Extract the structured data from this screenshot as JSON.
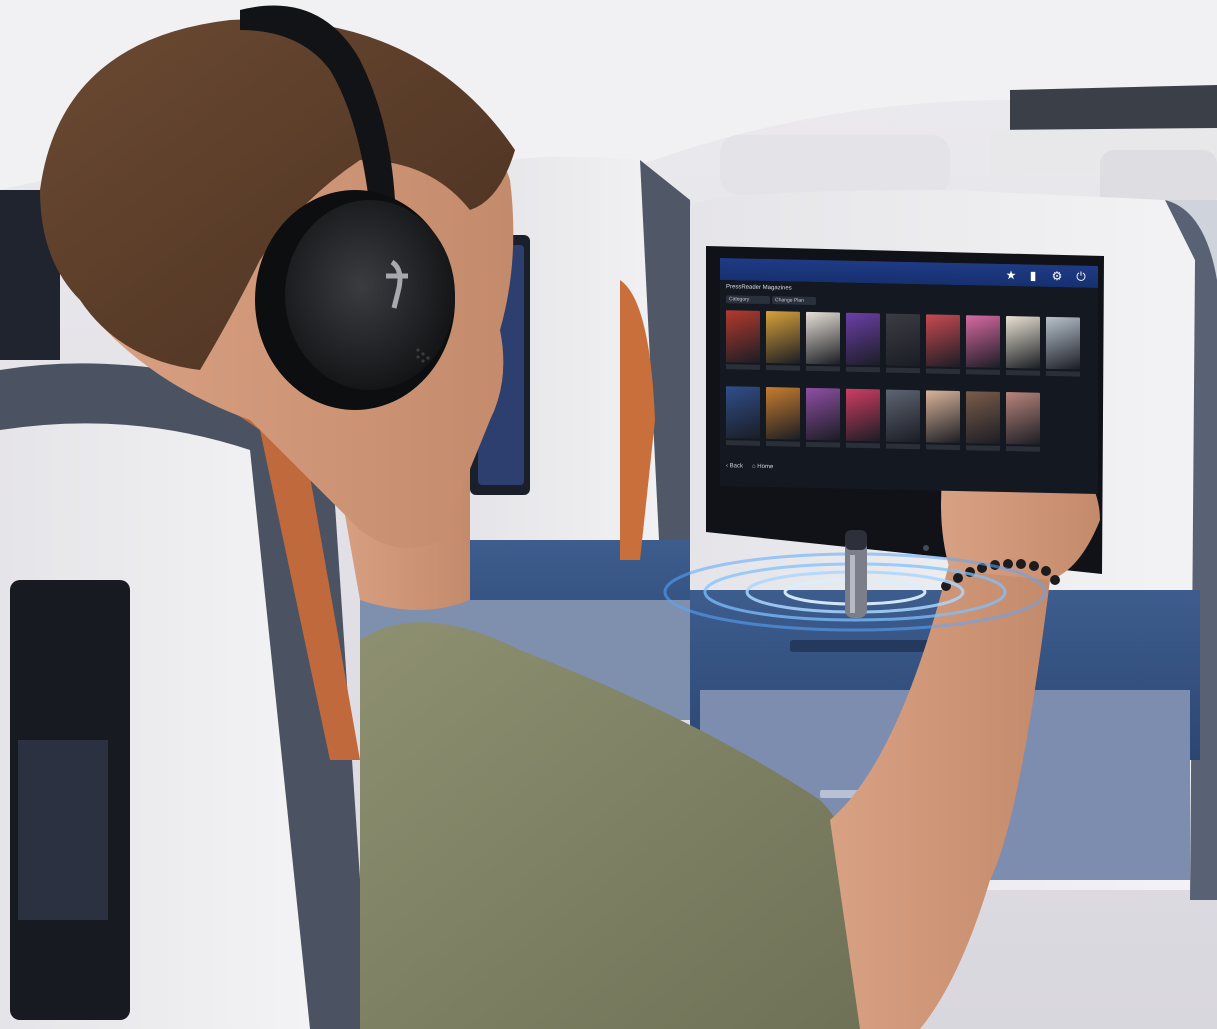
{
  "scene": {
    "description_icons": [
      "headphones-icon",
      "transmitter-icon",
      "wireless-waves-icon"
    ]
  },
  "ife": {
    "heading": "PressReader Magazines",
    "filters": [
      "Category",
      "Change Plan"
    ],
    "toolbar_icons": [
      "star-icon",
      "info-icon",
      "gear-icon",
      "power-icon"
    ],
    "nav_back": "Back",
    "nav_home": "Home",
    "colors": {
      "bar": "#1f3b86",
      "body": "#141821"
    },
    "magazines_row1": [
      "#b43a2e",
      "#d9a23a",
      "#e6e0d6",
      "#6c3fa8",
      "#3b3b44",
      "#c84a52",
      "#d86aa3",
      "#e8e2d2",
      "#b8c2cc"
    ],
    "magazines_row2": [
      "#2f4f8a",
      "#c77d2e",
      "#8e4fa3",
      "#cf3d62",
      "#5d6472",
      "#d9b49a",
      "#7a5c4a",
      "#b9857c"
    ]
  }
}
